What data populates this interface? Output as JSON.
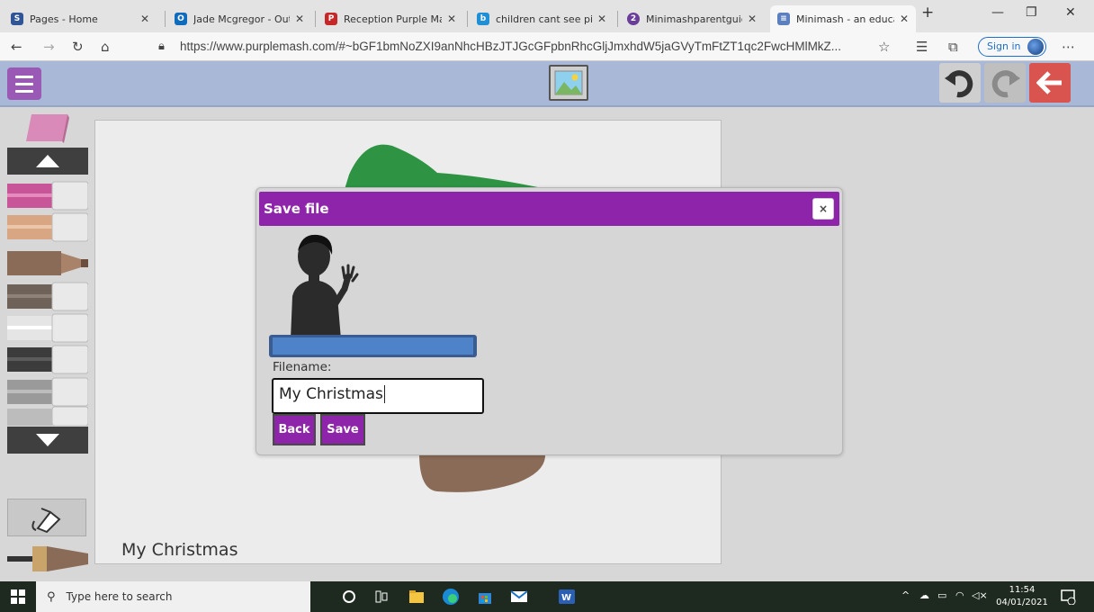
{
  "browser": {
    "tabs": [
      {
        "label": "Pages - Home",
        "icon": "sway-icon",
        "color": "#2f5597"
      },
      {
        "label": "Jade Mcgregor - Outlo",
        "icon": "outlook-icon",
        "color": "#0f6cbd"
      },
      {
        "label": "Reception Purple Mash",
        "icon": "pdf-icon",
        "color": "#c62828"
      },
      {
        "label": "children cant see pins c",
        "icon": "bing-icon",
        "color": "#1f8fd6"
      },
      {
        "label": "Minimashparentguidef",
        "icon": "number-badge-icon",
        "badge": "2",
        "color": "#6a3d9a"
      },
      {
        "label": "Minimash - an educatio",
        "icon": "minimash-icon",
        "color": "#5b7fbf"
      }
    ],
    "active_tab": 5,
    "url": "https://www.purplemash.com/#~bGF1bmNoZXI9anNhcHBzJTJGcGFpbnRhcGljJmxhdW5jaGVyTmFtZT1qc2FwcHMlMkZ...",
    "sign_in": "Sign in"
  },
  "app": {
    "canvas_title": "My Christmas",
    "colors": {
      "toolbar": "#a9b8d6",
      "menu": "#9b59b6",
      "back": "#d9534f",
      "canvas": "#ececec"
    }
  },
  "dialog": {
    "title": "Save file",
    "close": "×",
    "filename_label": "Filename:",
    "filename_value": "My Christmas",
    "back_label": "Back",
    "save_label": "Save",
    "color": "#8e24aa"
  },
  "taskbar": {
    "search_placeholder": "Type here to search",
    "time": "11:54",
    "date": "04/01/2021",
    "notifications": "5"
  }
}
